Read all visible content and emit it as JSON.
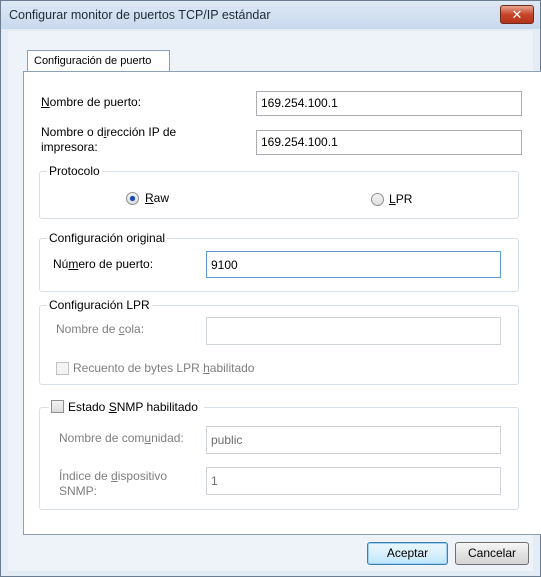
{
  "window": {
    "title": "Configurar monitor de puertos TCP/IP estándar",
    "close_glyph": "✕"
  },
  "tabs": [
    {
      "label": "Configuración de puerto",
      "selected": true
    }
  ],
  "port_name": {
    "label_prefix": "",
    "label_access": "N",
    "label_rest": "ombre de puerto:",
    "value": "169.254.100.1"
  },
  "printer_address": {
    "label_line1_prefix": "Nombre o d",
    "label_line1_access": "i",
    "label_line1_rest": "rección IP de",
    "label_line2": "impresora:",
    "value": "169.254.100.1"
  },
  "protocol": {
    "title": "Protocolo",
    "raw": {
      "access": "R",
      "rest": "aw",
      "checked": true
    },
    "lpr": {
      "access": "L",
      "rest": "PR",
      "checked": false
    }
  },
  "raw_settings": {
    "title": "Configuración original",
    "port_number_prefix": "Nú",
    "port_number_access": "m",
    "port_number_rest": "ero de puerto:",
    "port_number_value": "9100"
  },
  "lpr_settings": {
    "title": "Configuración LPR",
    "queue_prefix": "Nombre de ",
    "queue_access": "c",
    "queue_rest": "ola:",
    "queue_value": "",
    "byte_count_prefix": "Recuento de bytes LPR ",
    "byte_count_access": "h",
    "byte_count_rest": "abilitado",
    "byte_count_checked": false
  },
  "snmp": {
    "title_prefix": "Estado ",
    "title_access": "S",
    "title_rest": "NMP habilitado",
    "enabled": false,
    "community_prefix": "Nombre de com",
    "community_access": "u",
    "community_rest": "nidad:",
    "community_value": "public",
    "device_index_line1_prefix": "Índice de ",
    "device_index_line1_access": "d",
    "device_index_line1_rest": "ispositivo",
    "device_index_line2": "SNMP:",
    "device_index_value": "1"
  },
  "buttons": {
    "ok": "Aceptar",
    "cancel": "Cancelar"
  }
}
